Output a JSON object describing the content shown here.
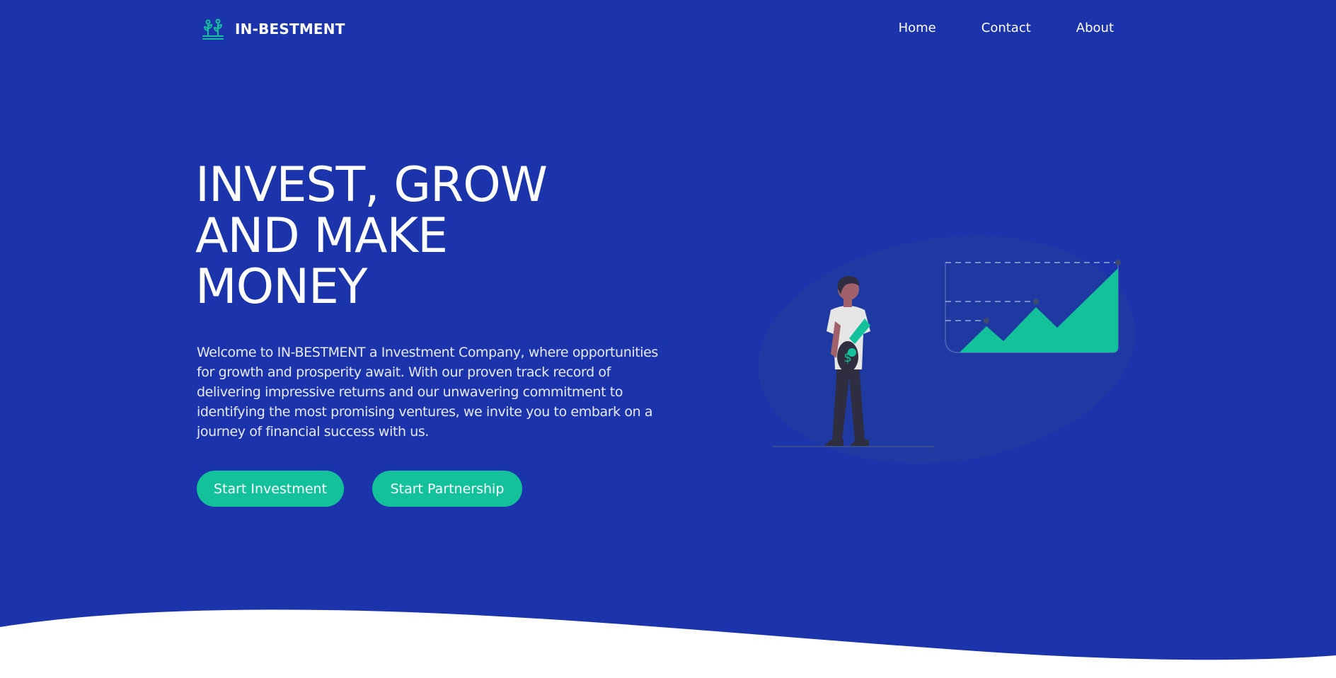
{
  "brand": {
    "name": "IN-BESTMENT",
    "logo_icon": "sprout-plant-icon",
    "accent_color": "#13c29a"
  },
  "nav": {
    "items": [
      {
        "label": "Home"
      },
      {
        "label": "Contact"
      },
      {
        "label": "About"
      }
    ]
  },
  "hero": {
    "title_lines": [
      "INVEST, GROW",
      "AND MAKE",
      "MONEY"
    ],
    "description": "Welcome to IN-BESTMENT a Investment Company, where opportunities for growth and prosperity await. With our proven track record of delivering impressive returns and our unwavering commitment to identifying the most promising ventures, we invite you to embark on a journey of financial success with us.",
    "buttons": {
      "invest_label": "Start Investment",
      "partner_label": "Start Partnership"
    },
    "background_color": "#1b34ab",
    "illustration": "person-holding-coin-with-growth-chart-illustration",
    "coin_symbol": "$"
  }
}
